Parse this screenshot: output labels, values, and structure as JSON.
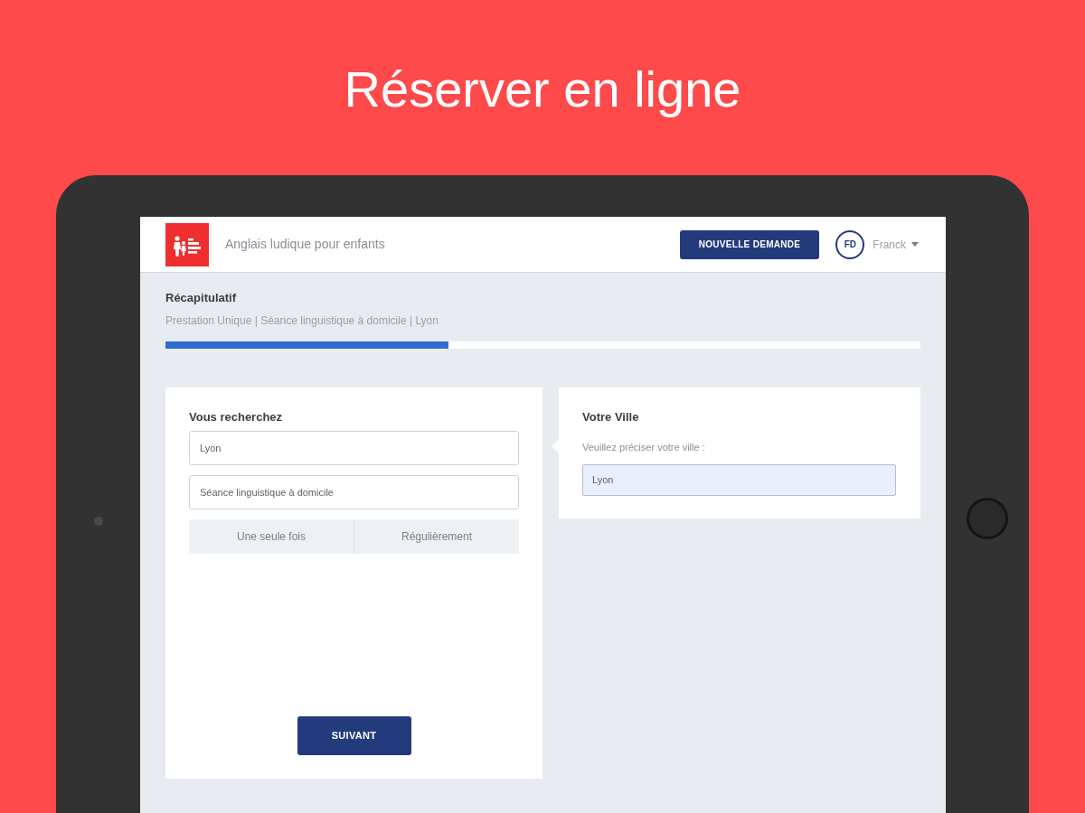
{
  "headline": "Réserver en ligne",
  "header": {
    "tagline": "Anglais ludique pour enfants",
    "new_request_button": "NOUVELLE DEMANDE",
    "user": {
      "initials": "FD",
      "name": "Franck"
    }
  },
  "summary": {
    "title": "Récapitulatif",
    "details": "Prestation Unique | Séance linguistique à domicile | Lyon",
    "progress": {
      "level": 0.375
    }
  },
  "search_card": {
    "title": "Vous recherchez",
    "fields": [
      {
        "value": "Lyon"
      },
      {
        "value": "Séance linguistique à domicile"
      }
    ],
    "frequency_options": [
      {
        "label": "Une seule fois",
        "selected": false
      },
      {
        "label": "Régulièrement",
        "selected": false
      }
    ],
    "next_button": "SUIVANT"
  },
  "city_card": {
    "title": "Votre Ville",
    "label": "Veuillez préciser votre ville :",
    "field": {
      "value": "Lyon",
      "focused": true
    }
  }
}
